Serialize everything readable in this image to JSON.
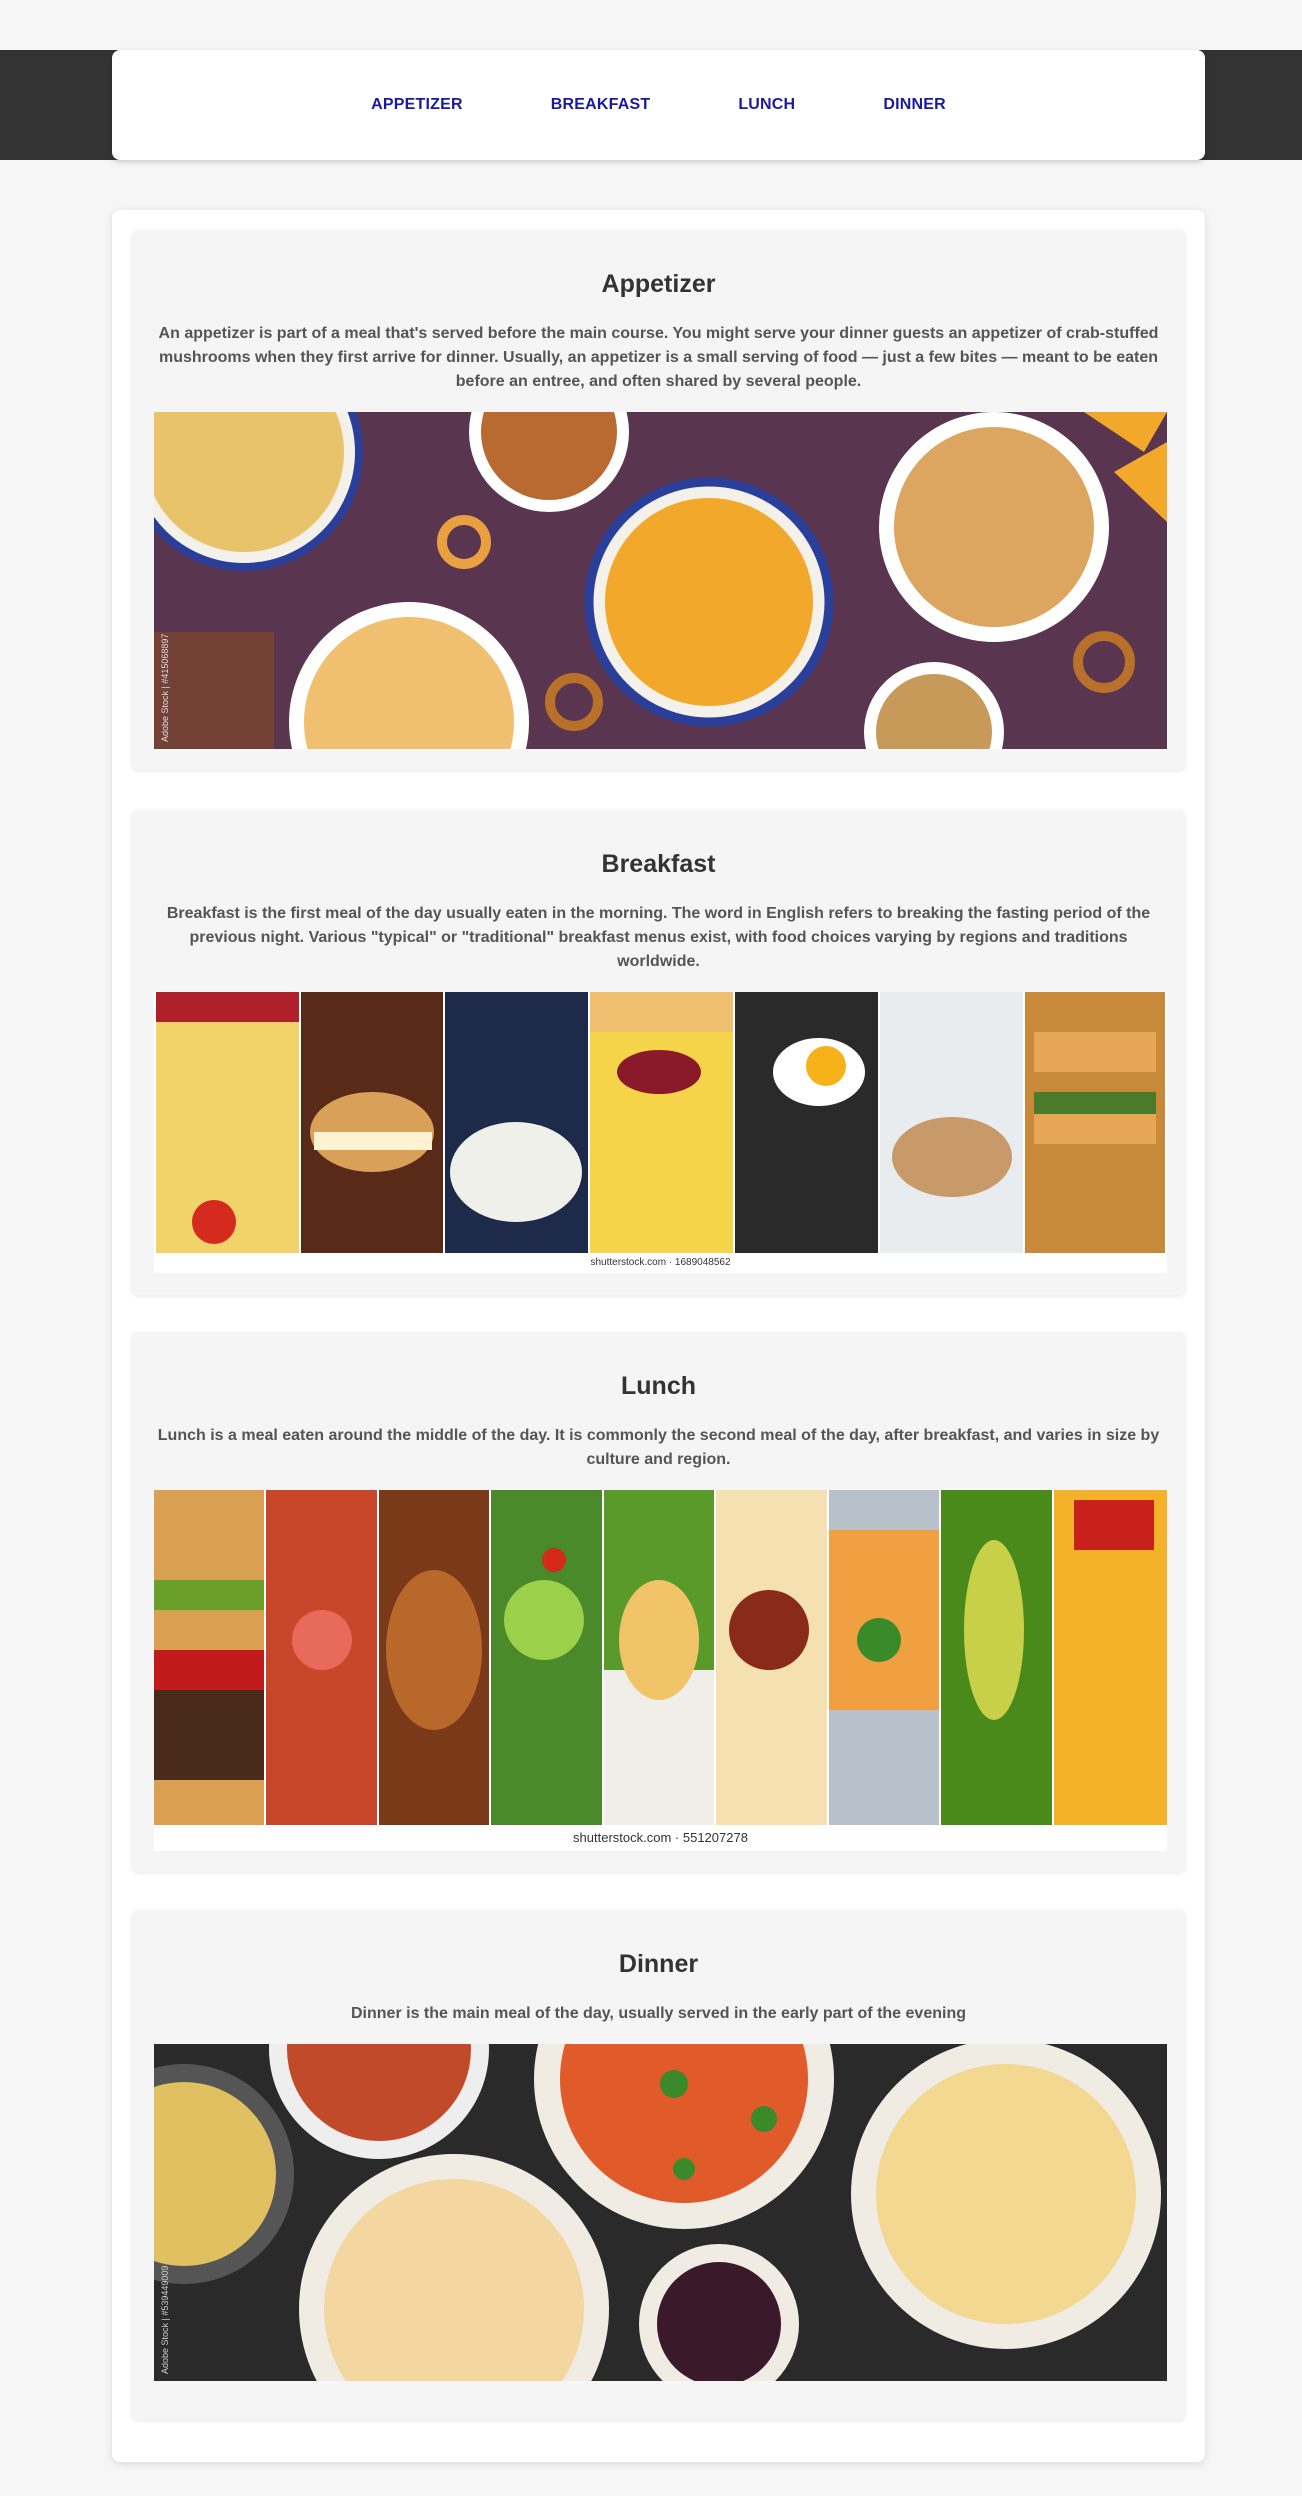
{
  "nav": {
    "items": [
      {
        "label": "APPETIZER"
      },
      {
        "label": "BREAKFAST"
      },
      {
        "label": "LUNCH"
      },
      {
        "label": "DINNER"
      }
    ]
  },
  "sections": [
    {
      "title": "Appetizer",
      "description": "An appetizer is part of a meal that's served before the main course. You might serve your dinner guests an appetizer of crab-stuffed mushrooms when they first arrive for dinner. Usually, an appetizer is a small serving of food — just a few bites — meant to be eaten before an entree, and often shared by several people.",
      "image_watermark": "Adobe Stock | #415068897"
    },
    {
      "title": "Breakfast",
      "description": "Breakfast is the first meal of the day usually eaten in the morning. The word in English refers to breaking the fasting period of the previous night. Various \"typical\" or \"traditional\" breakfast menus exist, with food choices varying by regions and traditions worldwide.",
      "image_caption": "shutterstock.com · 1689048562"
    },
    {
      "title": "Lunch",
      "description": "Lunch is a meal eaten around the middle of the day. It is commonly the second meal of the day, after breakfast, and varies in size by culture and region.",
      "image_caption": "shutterstock.com · 551207278"
    },
    {
      "title": "Dinner",
      "description": "Dinner is the main meal of the day, usually served in the early part of the evening",
      "image_watermark": "Adobe Stock | #539449009"
    }
  ],
  "colors": {
    "nav_link": "#1a1a9e",
    "band": "#333333",
    "appetizer_bg": "#5a3550",
    "dinner_bg": "#2a2a2a"
  }
}
